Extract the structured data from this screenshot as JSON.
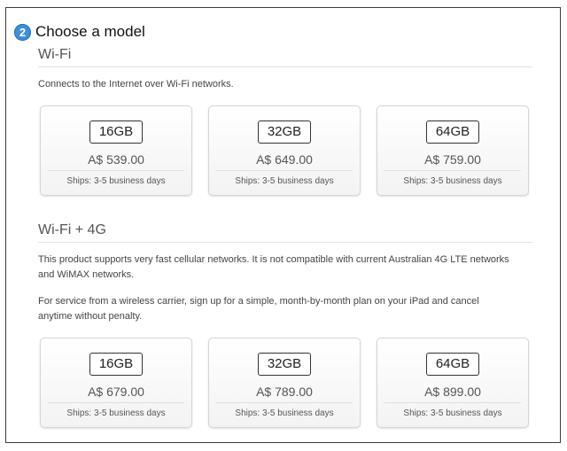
{
  "step": {
    "number": "2",
    "title": "Choose a model"
  },
  "wifi": {
    "heading": "Wi-Fi",
    "description": "Connects to the Internet over Wi-Fi networks.",
    "models": [
      {
        "capacity": "16GB",
        "price": "A$ 539.00",
        "ships": "Ships: 3-5 business days"
      },
      {
        "capacity": "32GB",
        "price": "A$ 649.00",
        "ships": "Ships: 3-5 business days"
      },
      {
        "capacity": "64GB",
        "price": "A$ 759.00",
        "ships": "Ships: 3-5 business days"
      }
    ]
  },
  "wifi4g": {
    "heading": "Wi-Fi + 4G",
    "description_line1": "This product supports very fast cellular networks. It is not compatible with current Australian 4G LTE networks",
    "description_line2": "and WiMAX networks.",
    "carrier_line1": "For service from a wireless carrier, sign up for a simple, month-by-month plan on your iPad and cancel",
    "carrier_line2": "anytime without penalty.",
    "models": [
      {
        "capacity": "16GB",
        "price": "A$ 679.00",
        "ships": "Ships: 3-5 business days"
      },
      {
        "capacity": "32GB",
        "price": "A$ 789.00",
        "ships": "Ships: 3-5 business days"
      },
      {
        "capacity": "64GB",
        "price": "A$ 899.00",
        "ships": "Ships: 3-5 business days"
      }
    ]
  },
  "colors": {
    "badge": "#3f8fd6",
    "border": "#3a3a3a"
  }
}
